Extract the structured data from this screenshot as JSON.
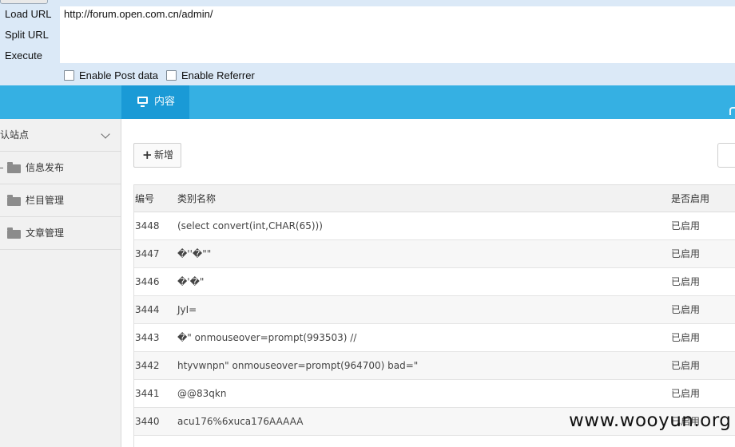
{
  "hackbar": {
    "load_url": "Load URL",
    "split_url": "Split URL",
    "execute": "Execute",
    "url": "http://forum.open.com.cn/admin/",
    "enable_post": "Enable Post data",
    "enable_referrer": "Enable Referrer"
  },
  "topbar": {
    "tab_content": "内容",
    "accent": "#35b0e3",
    "active_tab_color": "#1a9ad6"
  },
  "sidebar": {
    "site_select": "默认站点",
    "items": [
      {
        "label": "信息发布",
        "icon": "folder-icon"
      },
      {
        "label": "栏目管理",
        "icon": "folder-icon"
      },
      {
        "label": "文章管理",
        "icon": "folder-icon"
      }
    ]
  },
  "main": {
    "add_button": "新增",
    "columns": {
      "id": "编号",
      "name": "类别名称",
      "status": "是否启用"
    },
    "rows": [
      {
        "id": "3448",
        "name": "(select convert(int,CHAR(65)))",
        "status": "已启用"
      },
      {
        "id": "3447",
        "name": "�''�\"\"",
        "status": "已启用"
      },
      {
        "id": "3446",
        "name": "�'�\"",
        "status": "已启用"
      },
      {
        "id": "3444",
        "name": "JyI=",
        "status": "已启用"
      },
      {
        "id": "3443",
        "name": "�\" onmouseover=prompt(993503) //",
        "status": "已启用"
      },
      {
        "id": "3442",
        "name": "htyvwnpn\" onmouseover=prompt(964700) bad=\"",
        "status": "已启用"
      },
      {
        "id": "3441",
        "name": "@@83qkn",
        "status": "已启用"
      },
      {
        "id": "3440",
        "name": "acu176%6xuca176AAAAA",
        "status": "已启用"
      }
    ]
  },
  "watermark": "www.wooyun.org"
}
